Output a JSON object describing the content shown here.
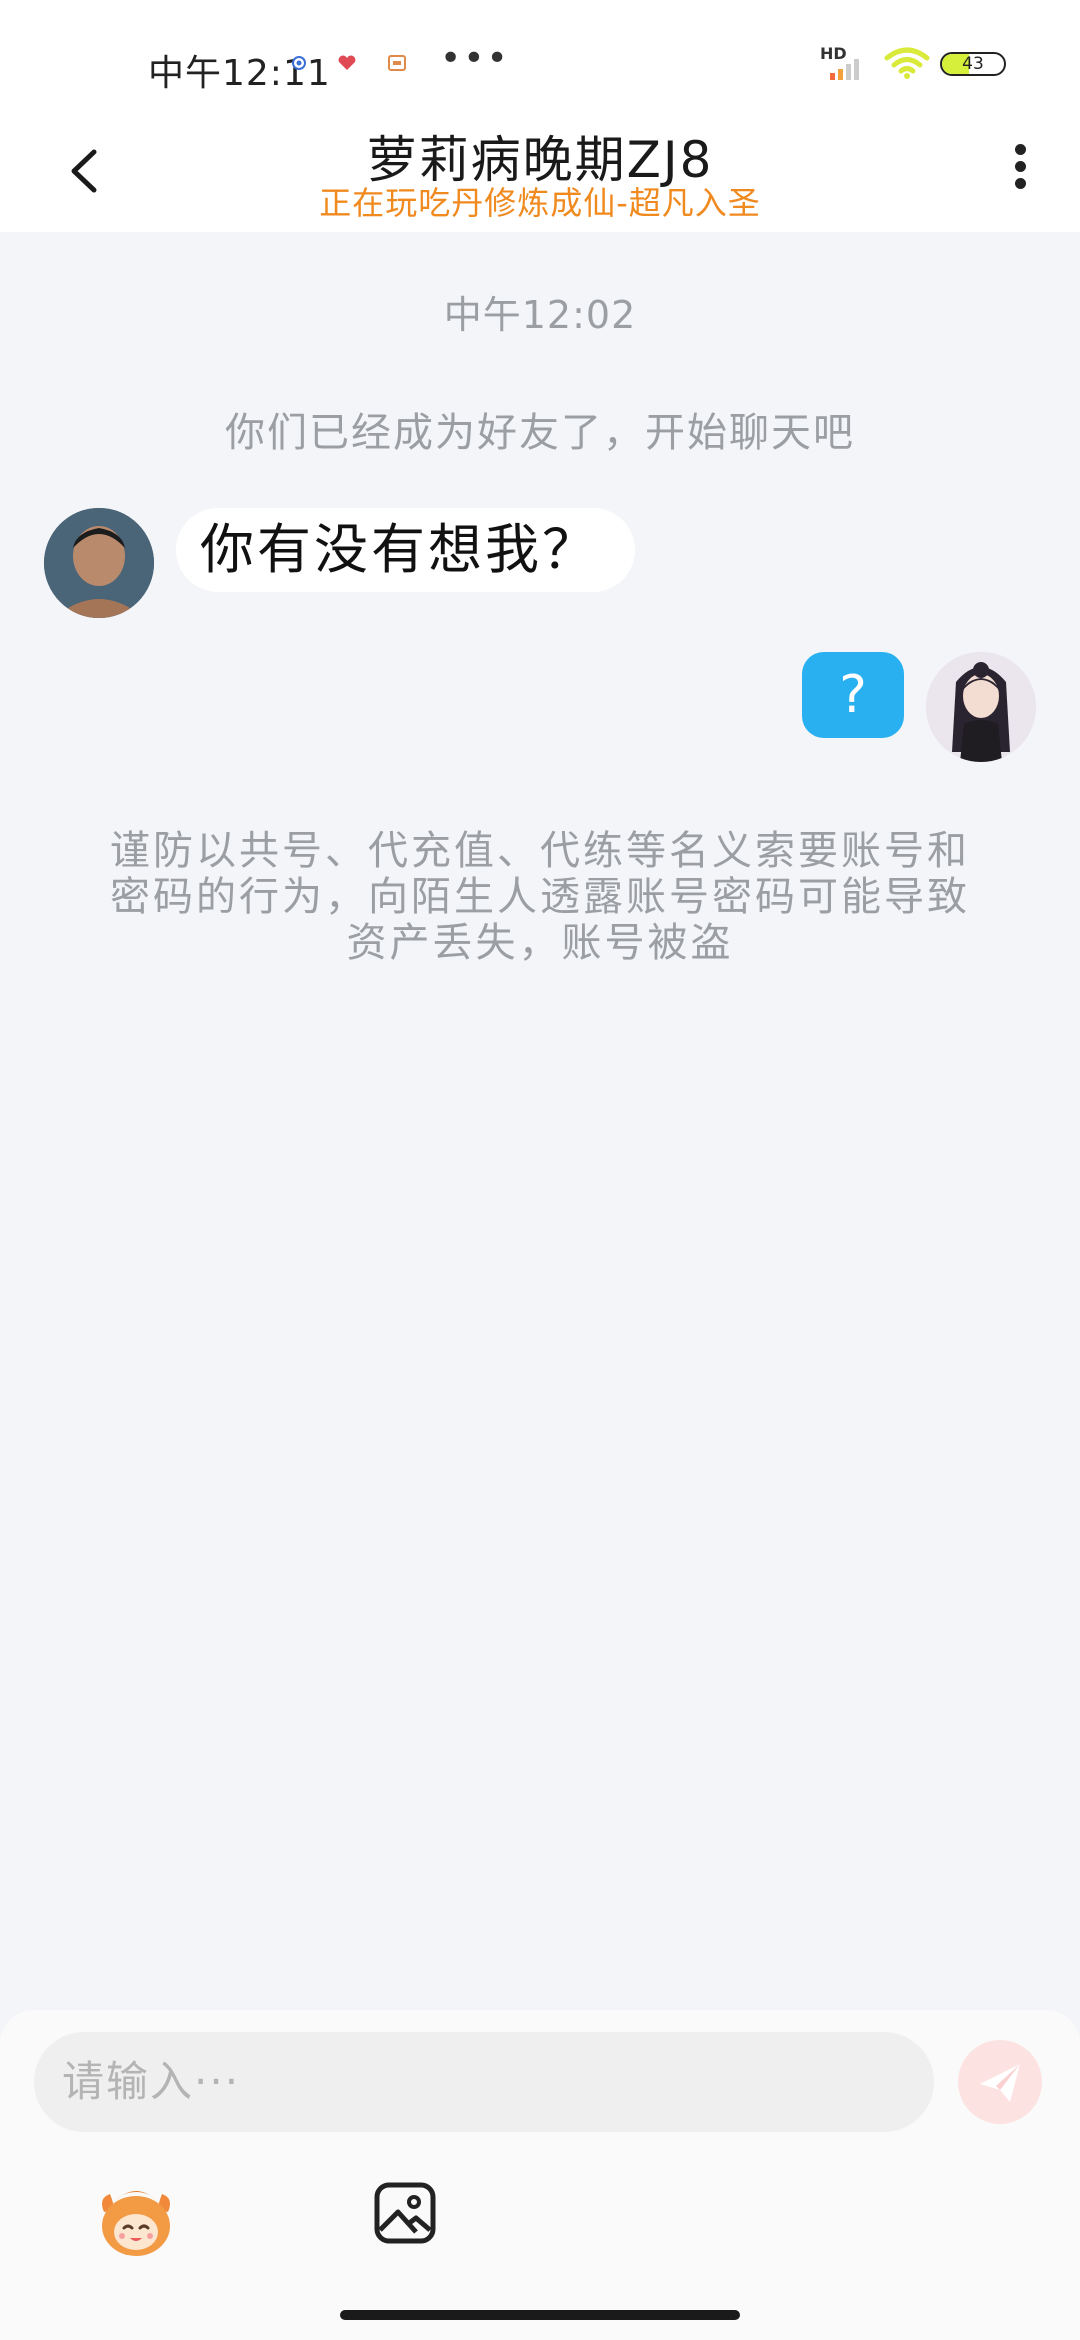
{
  "status_bar": {
    "time": "中午12:11",
    "more": "•••",
    "network_label": "HD",
    "battery_level": "43"
  },
  "header": {
    "title": "萝莉病晚期ZJ8",
    "subtitle": "正在玩吃丹修炼成仙-超凡入圣"
  },
  "chat": {
    "timestamp": "中午12:02",
    "system_message": "你们已经成为好友了，开始聊天吧",
    "messages": [
      {
        "side": "left",
        "text": "你有没有想我？"
      },
      {
        "side": "right",
        "text": "?"
      }
    ],
    "warning": "谨防以共号、代充值、代练等名义索要账号和密码的行为，向陌生人透露账号密码可能导致资产丢失，账号被盗"
  },
  "input": {
    "placeholder": "请输入···"
  },
  "colors": {
    "accent_orange": "#f08a1f",
    "bubble_blue": "#29b0f0",
    "background": "#f3f5f8",
    "send_button": "#fde2e2"
  },
  "icons": [
    "back-arrow-icon",
    "more-vertical-icon",
    "send-icon",
    "mascot-icon",
    "image-icon",
    "wifi-icon",
    "signal-icon",
    "battery-icon"
  ]
}
